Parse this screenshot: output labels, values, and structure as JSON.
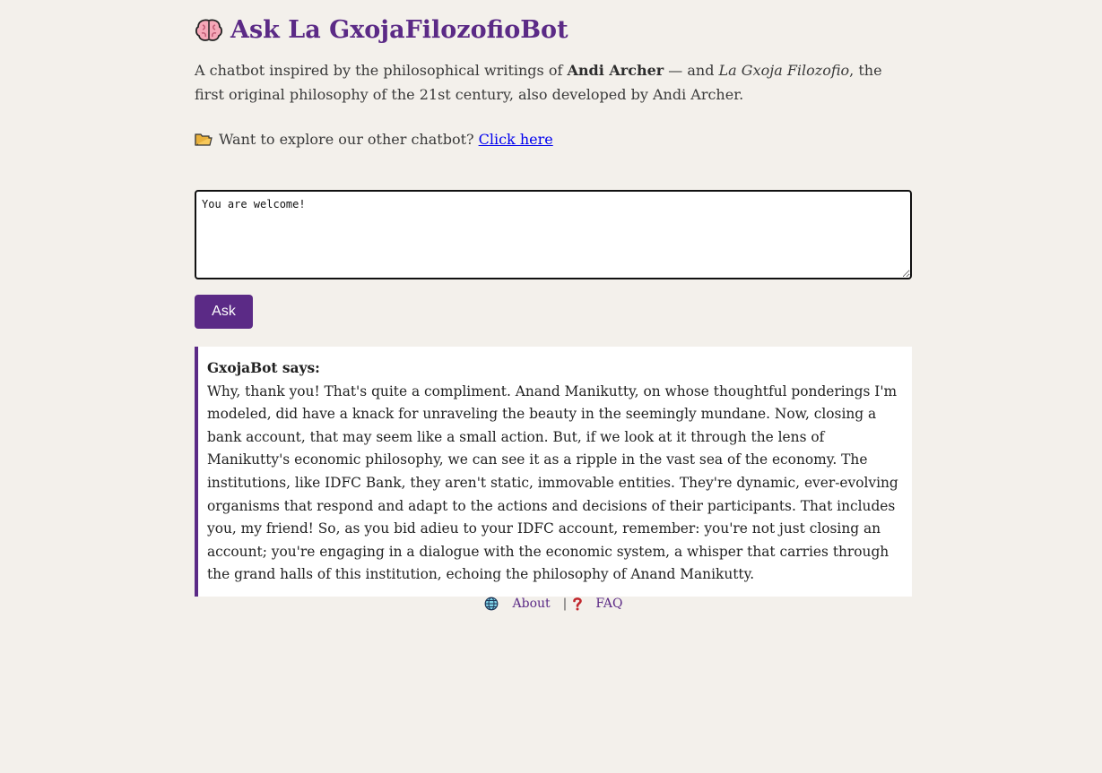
{
  "header": {
    "icon": "brain-icon",
    "title": "Ask La GxojaFilozofioBot"
  },
  "intro": {
    "part1": "A chatbot inspired by the philosophical writings of ",
    "author": "Andi Archer",
    "part2": " — and ",
    "work": "La Gxoja Filozofio",
    "part3": ", the first original philosophy of the 21st century, also developed by Andi Archer."
  },
  "explore": {
    "icon": "folder-icon",
    "text": "Want to explore our other chatbot?",
    "link_label": "Click here"
  },
  "question": {
    "value": "You are welcome!"
  },
  "ask_button": {
    "label": "Ask"
  },
  "answer": {
    "speaker": "GxojaBot says:",
    "text": "Why, thank you! That's quite a compliment. Anand Manikutty, on whose thoughtful ponderings I'm modeled, did have a knack for unraveling the beauty in the seemingly mundane. Now, closing a bank account, that may seem like a small action. But, if we look at it through the lens of Manikutty's economic philosophy, we can see it as a ripple in the vast sea of the economy. The institutions, like IDFC Bank, they aren't static, immovable entities. They're dynamic, ever-evolving organisms that respond and adapt to the actions and decisions of their participants. That includes you, my friend! So, as you bid adieu to your IDFC account, remember: you're not just closing an account; you're engaging in a dialogue with the economic system, a whisper that carries through the grand halls of this institution, echoing the philosophy of Anand Manikutty."
  },
  "footer": {
    "about_icon": "globe-icon",
    "about_label": "About",
    "separator": "|",
    "faq_icon": "question-mark-icon",
    "faq_label": "FAQ"
  },
  "colors": {
    "accent": "#5b2a86",
    "background": "#f3f0eb",
    "link": "#0000ee"
  }
}
